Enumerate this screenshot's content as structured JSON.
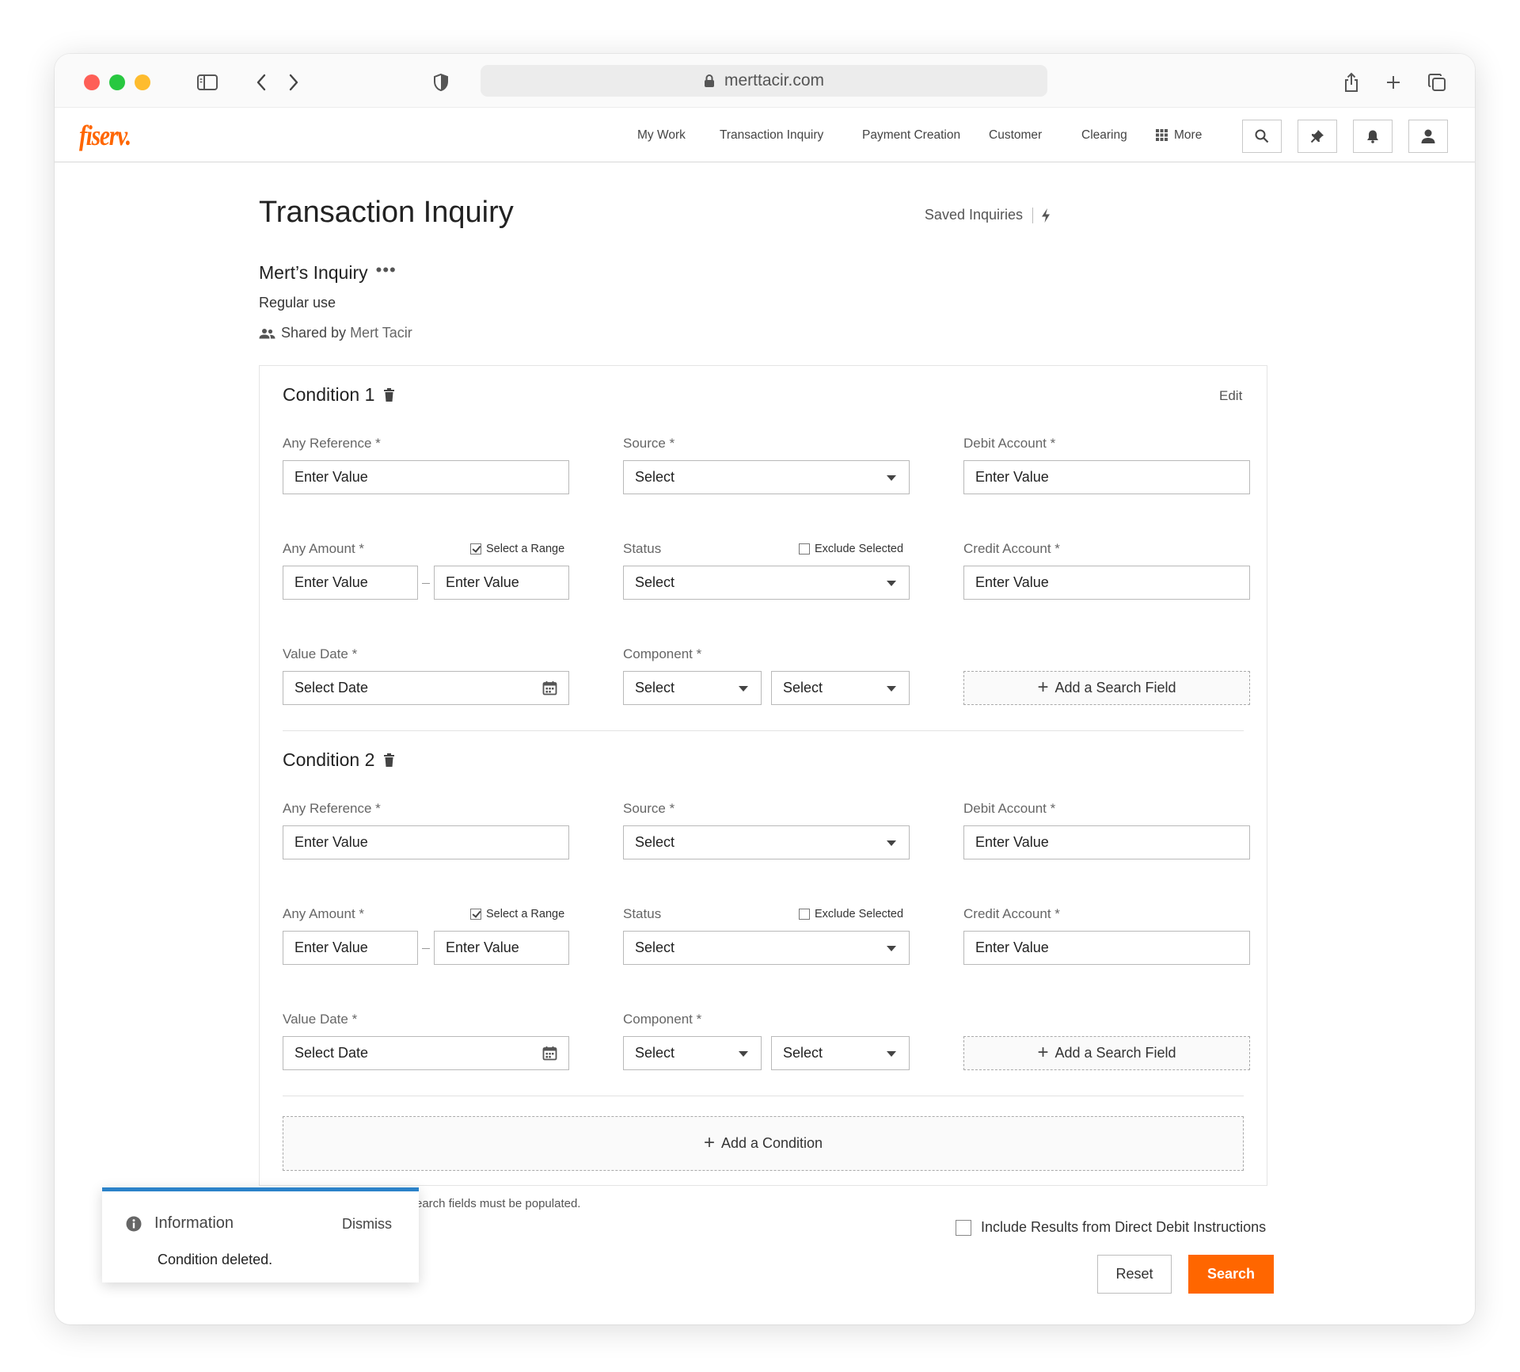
{
  "browser": {
    "url": "merttacir.com"
  },
  "brand": {
    "logo_text": "fiserv.",
    "accent_color": "#ff6600",
    "info_color": "#2b82c9"
  },
  "nav": {
    "items": [
      "My Work",
      "Transaction Inquiry",
      "Payment Creation",
      "Customer",
      "Clearing"
    ],
    "more_label": "More"
  },
  "page": {
    "title": "Transaction Inquiry",
    "saved_inquiries_label": "Saved Inquiries"
  },
  "inquiry": {
    "name": "Mert’s Inquiry",
    "more_glyph": "•••",
    "description": "Regular use",
    "shared_prefix": "Shared by",
    "shared_by": "Mert Tacir"
  },
  "edit_label": "Edit",
  "conditions": [
    {
      "title": "Condition 1",
      "any_reference": {
        "label": "Any Reference *",
        "placeholder": "Enter Value"
      },
      "source": {
        "label": "Source *",
        "value": "Select"
      },
      "debit_account": {
        "label": "Debit Account *",
        "placeholder": "Enter Value"
      },
      "any_amount": {
        "label": "Any Amount *",
        "range_label": "Select a Range",
        "range_checked": true,
        "from_placeholder": "Enter Value",
        "to_placeholder": "Enter Value"
      },
      "status": {
        "label": "Status",
        "exclude_label": "Exclude Selected",
        "exclude_checked": false,
        "value": "Select"
      },
      "credit_account": {
        "label": "Credit Account *",
        "placeholder": "Enter Value"
      },
      "value_date": {
        "label": "Value Date *",
        "placeholder": "Select Date"
      },
      "component": {
        "label": "Component *",
        "value_1": "Select",
        "value_2": "Select"
      },
      "add_field_label": "Add a Search Field"
    },
    {
      "title": "Condition 2",
      "any_reference": {
        "label": "Any Reference *",
        "placeholder": "Enter Value"
      },
      "source": {
        "label": "Source *",
        "value": "Select"
      },
      "debit_account": {
        "label": "Debit Account *",
        "placeholder": "Enter Value"
      },
      "any_amount": {
        "label": "Any Amount *",
        "range_label": "Select a Range",
        "range_checked": true,
        "from_placeholder": "Enter Value",
        "to_placeholder": "Enter Value"
      },
      "status": {
        "label": "Status",
        "exclude_label": "Exclude Selected",
        "exclude_checked": false,
        "value": "Select"
      },
      "credit_account": {
        "label": "Credit Account *",
        "placeholder": "Enter Value"
      },
      "value_date": {
        "label": "Value Date *",
        "placeholder": "Select Date"
      },
      "component": {
        "label": "Component *",
        "value_1": "Select",
        "value_2": "Select"
      },
      "add_field_label": "Add a Search Field"
    }
  ],
  "add_condition_label": "Add a Condition",
  "footer": {
    "note_visible": "earch fields must be populated.",
    "direct_debit_label": "Include Results from Direct Debit Instructions",
    "reset_label": "Reset",
    "search_label": "Search"
  },
  "toast": {
    "title": "Information",
    "dismiss_label": "Dismiss",
    "message": "Condition deleted."
  },
  "icons": [
    "sidebar-icon",
    "back-chevron-icon",
    "forward-chevron-icon",
    "shield-icon",
    "lock-icon",
    "share-icon",
    "new-tab-icon",
    "tabs-icon",
    "grid-icon",
    "search-icon",
    "pin-icon",
    "bell-icon",
    "user-icon",
    "bolt-icon",
    "people-icon",
    "trash-icon",
    "calendar-icon",
    "info-icon"
  ]
}
